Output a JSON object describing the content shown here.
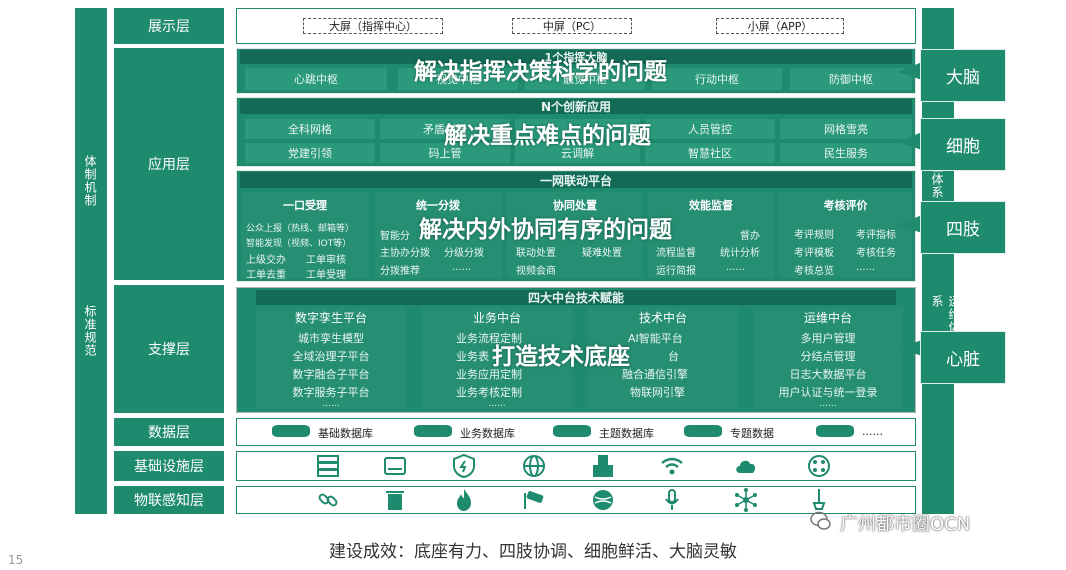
{
  "left_bars": {
    "top": "体制机制",
    "bottom": "标准规范"
  },
  "right_bars": {
    "top": "全体系",
    "bottom": "运维体系"
  },
  "layers": [
    "展示层",
    "应用层",
    "支撑层",
    "数据层",
    "基础设施层",
    "物联感知层"
  ],
  "display": {
    "boxes": [
      "大屏（指挥中心）",
      "中屏（PC）",
      "小屏（APP）"
    ]
  },
  "app_top": {
    "strip": "1个指挥大脑",
    "cells": [
      "心跳中枢",
      "视觉中枢",
      "触觉中枢",
      "行动中枢",
      "防御中枢"
    ],
    "overlay": "解决指挥决策科学的问题"
  },
  "app_mid": {
    "strip": "N个创新应用",
    "row1": [
      "全科网格",
      "矛盾纠纷",
      "",
      "人员管控",
      "网格雪亮"
    ],
    "row2": [
      "党建引领",
      "码上管",
      "云调解",
      "智慧社区",
      "民生服务"
    ],
    "overlay": "解决重点难点的问题"
  },
  "app_bot": {
    "strip": "一网联动平台",
    "columns": [
      {
        "title": "一口受理",
        "items": [
          "公众上报（热线、邮箱等）",
          "智能发现（视频、IOT等）",
          "上级交办",
          "工单审核",
          "工单去重",
          "工单受理"
        ]
      },
      {
        "title": "统一分拨",
        "items": [
          "智能分",
          "主协办分拨",
          "分级分拨",
          "分拨推荐",
          "......"
        ]
      },
      {
        "title": "协同处置",
        "items": [
          "联动处置",
          "疑难处置",
          "视频会商"
        ]
      },
      {
        "title": "效能监督",
        "items": [
          "督办",
          "流程监督",
          "统计分析",
          "运行简报",
          "......"
        ]
      },
      {
        "title": "考核评价",
        "items": [
          "考评规则",
          "考评指标",
          "考评模板",
          "考核任务",
          "考核总览",
          "......"
        ]
      }
    ],
    "overlay": "解决内外协同有序的问题"
  },
  "support": {
    "strip": "四大中台技术赋能",
    "columns": [
      {
        "title": "数字孪生平台",
        "items": [
          "城市孪生模型",
          "全域治理子平台",
          "数字融合子平台",
          "数字服务子平台",
          "......"
        ]
      },
      {
        "title": "业务中台",
        "items": [
          "业务流程定制",
          "业务表",
          "业务应用定制",
          "业务考核定制",
          "......"
        ]
      },
      {
        "title": "技术中台",
        "items": [
          "AI智能平台",
          "台",
          "融合通信引擎",
          "物联网引擎"
        ]
      },
      {
        "title": "运维中台",
        "items": [
          "多用户管理",
          "分结点管理",
          "日志大数据平台",
          "用户认证与统一登录",
          "......"
        ]
      }
    ],
    "overlay": "打造技术底座"
  },
  "data_layer": [
    "基础数据库",
    "业务数据库",
    "主题数据库",
    "专题数据",
    "......"
  ],
  "infra_icons": [
    "server-icon",
    "storage-icon",
    "firewall-icon",
    "globe-icon",
    "datacenter-icon",
    "wifi-icon",
    "cloud-icon",
    "hub-icon"
  ],
  "iot_icons": [
    "link-icon",
    "trash-icon",
    "fire-icon",
    "camera-icon",
    "sphere-icon",
    "microphone-icon",
    "network-icon",
    "sensor-icon"
  ],
  "callouts": [
    "大脑",
    "细胞",
    "四肢",
    "心脏"
  ],
  "footer": "建设成效：底座有力、四肢协调、细胞鲜活、大脑灵敏",
  "watermark": "广州都市圈OCN",
  "page_number": "15"
}
